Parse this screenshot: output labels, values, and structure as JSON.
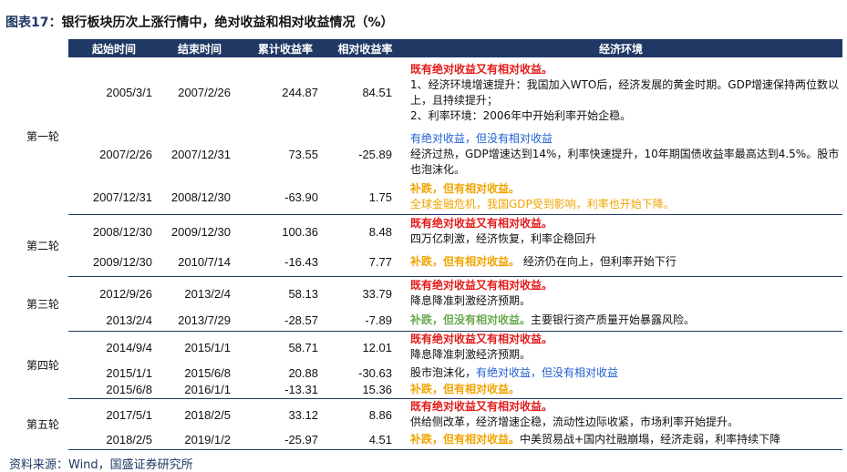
{
  "title": {
    "prefix": "图表17：",
    "text": "银行板块历次上涨行情中，绝对收益和相对收益情况（%）"
  },
  "headers": {
    "start": "起始时间",
    "end": "结束时间",
    "cum": "累计收益率",
    "rel": "相对收益率",
    "env": "经济环境"
  },
  "rounds": [
    "第一轮",
    "第二轮",
    "第三轮",
    "第四轮",
    "第五轮"
  ],
  "rows": [
    {
      "start": "2005/3/1",
      "end": "2007/2/26",
      "cum": "244.87",
      "rel": "84.51",
      "env": {
        "tag": "既有绝对收益又有相对收益。",
        "line1": "1、经济环境增速提升：我国加入WTO后，经济发展的黄金时期。GDP增速保持两位数以上，且持续提升；",
        "line2": "2、利率环境：2006年中开始利率开始企稳。"
      }
    },
    {
      "start": "2007/2/26",
      "end": "2007/12/31",
      "cum": "73.55",
      "rel": "-25.89",
      "env": {
        "tag": "有绝对收益，但没有相对收益",
        "line1": "经济过热，GDP增速达到14%，利率快速提升，10年期国债收益率最高达到4.5%。股市也泡沫化。"
      }
    },
    {
      "start": "2007/12/31",
      "end": "2008/12/30",
      "cum": "-63.90",
      "rel": "1.75",
      "env": {
        "tag": "补跌，但有相对收益。",
        "line1": "全球金融危机，我国GDP受到影响，利率也开始下降。"
      }
    },
    {
      "start": "2008/12/30",
      "end": "2009/12/30",
      "cum": "100.36",
      "rel": "8.48",
      "env": {
        "tag": "既有绝对收益又有相对收益。",
        "line1": "四万亿刺激，经济恢复，利率企稳回升"
      }
    },
    {
      "start": "2009/12/30",
      "end": "2010/7/14",
      "cum": "-16.43",
      "rel": "7.77",
      "env": {
        "tag": "补跌，但有相对收益。",
        "line1": "经济仍在向上，但利率开始下行"
      }
    },
    {
      "start": "2012/9/26",
      "end": "2013/2/4",
      "cum": "58.13",
      "rel": "33.79",
      "env": {
        "tag": "既有绝对收益又有相对收益。",
        "line1": "降息降准刺激经济预期。"
      }
    },
    {
      "start": "2013/2/4",
      "end": "2013/7/29",
      "cum": "-28.57",
      "rel": "-7.89",
      "env": {
        "tag": "补跌，但没有相对收益。",
        "line1": "主要银行资产质量开始暴露风险。"
      }
    },
    {
      "start": "2014/9/4",
      "end": "2015/1/1",
      "cum": "58.71",
      "rel": "12.01",
      "env": {
        "tag": "既有绝对收益又有相对收益。",
        "line1": "降息降准刺激经济预期。"
      }
    },
    {
      "start": "2015/1/1",
      "end": "2015/6/8",
      "cum": "20.88",
      "rel": "-30.63",
      "env": {
        "pre": "股市泡沫化，",
        "tag": "有绝对收益，但没有相对收益"
      }
    },
    {
      "start": "2015/6/8",
      "end": "2016/1/1",
      "cum": "-13.31",
      "rel": "15.36",
      "env": {
        "tag": "补跌，但有相对收益。"
      }
    },
    {
      "start": "2017/5/1",
      "end": "2018/2/5",
      "cum": "33.12",
      "rel": "8.86",
      "env": {
        "tag": "既有绝对收益又有相对收益。",
        "line1": "供给侧改革，经济增速企稳，流动性边际收紧，市场利率开始提升。"
      }
    },
    {
      "start": "2018/2/5",
      "end": "2019/1/2",
      "cum": "-25.97",
      "rel": "4.51",
      "env": {
        "tag": "补跌，但有相对收益。",
        "line1": "中美贸易战+国内社融崩塌，经济走弱，利率持续下降"
      }
    }
  ],
  "source": "资料来源：Wind，国盛证券研究所"
}
